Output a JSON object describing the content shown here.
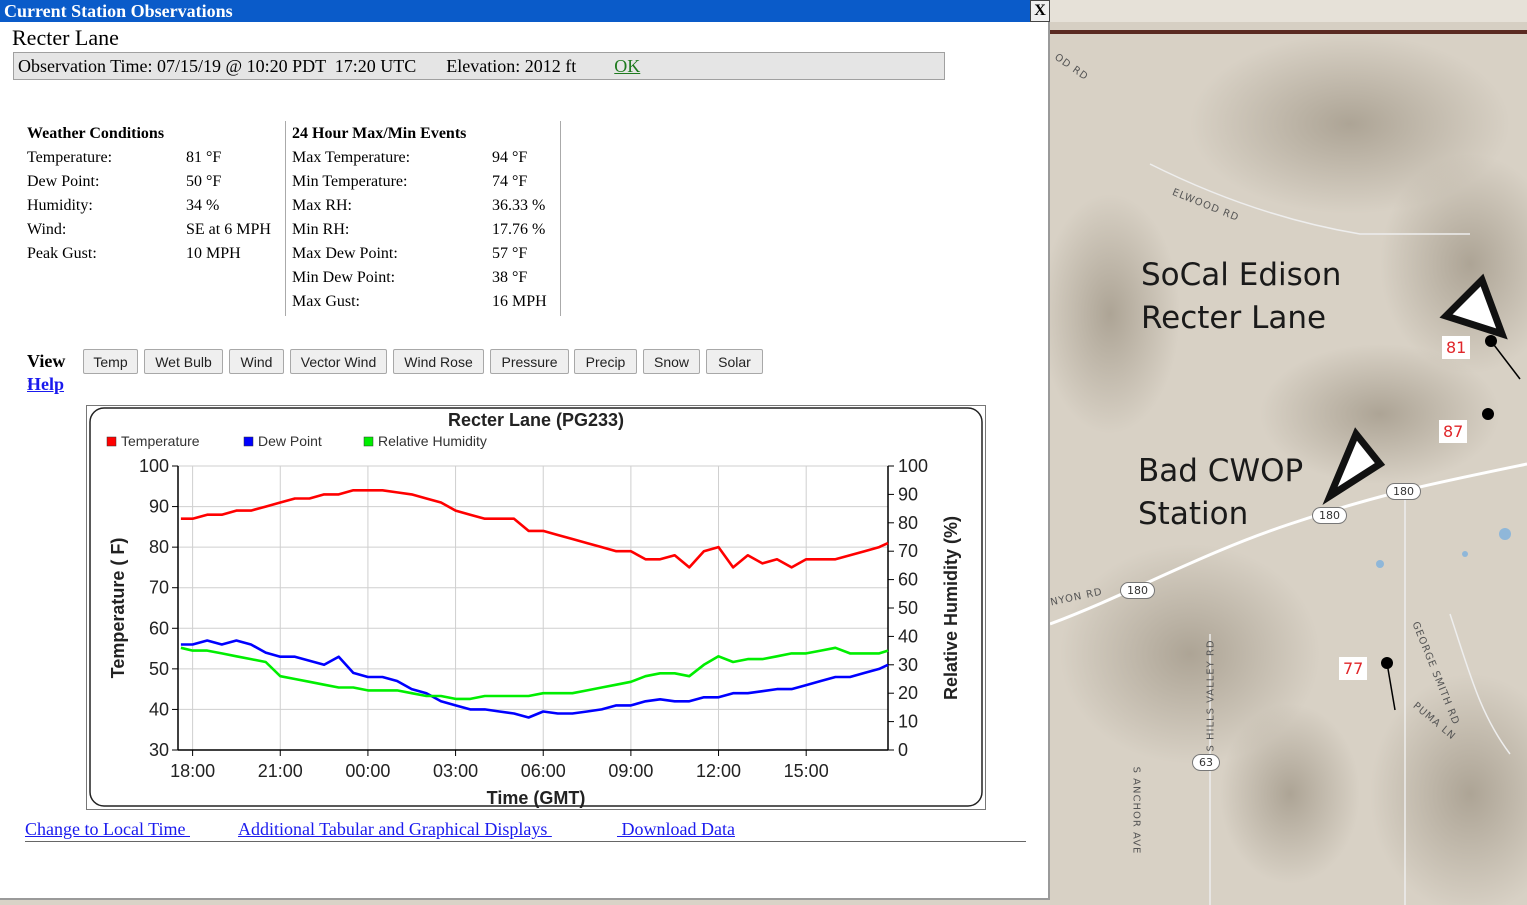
{
  "window": {
    "title": "Current Station Observations",
    "close_label": "X"
  },
  "station": {
    "name": "Recter Lane",
    "obs_time": "Observation Time: 07/15/19 @ 10:20 PDT  17:20 UTC",
    "elevation": "Elevation: 2012 ft",
    "ok_label": "OK"
  },
  "weather": {
    "heading": "Weather Conditions",
    "rows": [
      {
        "label": "Temperature:",
        "value": "81 °F"
      },
      {
        "label": "Dew Point:",
        "value": "50 °F"
      },
      {
        "label": "Humidity:",
        "value": "34 %"
      },
      {
        "label": "Wind:",
        "value": "SE at 6 MPH"
      },
      {
        "label": "Peak Gust:",
        "value": "10 MPH"
      }
    ]
  },
  "maxmin": {
    "heading": "24 Hour Max/Min Events",
    "rows": [
      {
        "label": "Max Temperature:",
        "value": "94 °F"
      },
      {
        "label": "Min Temperature:",
        "value": "74 °F"
      },
      {
        "label": "Max RH:",
        "value": "36.33 %"
      },
      {
        "label": "Min RH:",
        "value": "17.76 %"
      },
      {
        "label": "Max Dew Point:",
        "value": "57 °F"
      },
      {
        "label": "Min Dew Point:",
        "value": "38 °F"
      },
      {
        "label": "Max Gust:",
        "value": "16 MPH"
      }
    ]
  },
  "view": {
    "label": "View :",
    "buttons": [
      "Temp",
      "Wet Bulb",
      "Wind",
      "Vector Wind",
      "Wind Rose",
      "Pressure",
      "Precip",
      "Snow",
      "Solar"
    ],
    "help_label": "Help"
  },
  "links": {
    "local_time": "Change to Local Time ",
    "tabular": "Additional Tabular and Graphical Displays ",
    "download": " Download Data"
  },
  "colors": {
    "titlebar": "#0a5bc9",
    "temperature": "#ff0000",
    "dew_point": "#0000ff",
    "humidity": "#00ee00"
  },
  "chart_data": {
    "type": "line",
    "title": "Recter Lane (PG233)",
    "xlabel": "Time (GMT)",
    "ylabel": "Temperature ( F)",
    "y2label": "Relative Humidity (%)",
    "legend_placement": "top-left",
    "xlim": [
      17.5,
      41.8
    ],
    "ylim": [
      30,
      100
    ],
    "y2lim": [
      0,
      100
    ],
    "xticks": [
      18,
      21,
      24,
      27,
      30,
      33,
      36,
      39
    ],
    "xtick_labels": [
      "18:00",
      "21:00",
      "00:00",
      "03:00",
      "06:00",
      "09:00",
      "12:00",
      "15:00"
    ],
    "yticks": [
      30,
      40,
      50,
      60,
      70,
      80,
      90,
      100
    ],
    "y2ticks": [
      0,
      10,
      20,
      30,
      40,
      50,
      60,
      70,
      80,
      90,
      100
    ],
    "grid": true,
    "series": [
      {
        "name": "Temperature",
        "axis": "left",
        "x": [
          17.6,
          18.0,
          18.5,
          19.0,
          19.5,
          20.0,
          20.5,
          21.0,
          21.5,
          22.0,
          22.5,
          23.0,
          23.5,
          24.0,
          24.5,
          25.0,
          25.5,
          26.0,
          26.5,
          27.0,
          27.5,
          28.0,
          28.5,
          29.0,
          29.5,
          30.0,
          30.5,
          31.0,
          31.5,
          32.0,
          32.5,
          33.0,
          33.5,
          34.0,
          34.5,
          35.0,
          35.5,
          36.0,
          36.5,
          37.0,
          37.5,
          38.0,
          38.5,
          39.0,
          39.5,
          40.0,
          40.5,
          41.0,
          41.5,
          41.8
        ],
        "values": [
          87,
          87,
          88,
          88,
          89,
          89,
          90,
          91,
          92,
          92,
          93,
          93,
          94,
          94,
          94,
          93.5,
          93,
          92,
          91,
          89,
          88,
          87,
          87,
          87,
          84,
          84,
          83,
          82,
          81,
          80,
          79,
          79,
          77,
          77,
          78,
          75,
          79,
          80,
          75,
          78,
          76,
          77,
          75,
          77,
          77,
          77,
          78,
          79,
          80,
          81
        ]
      },
      {
        "name": "Dew Point",
        "axis": "left",
        "x": [
          17.6,
          18.0,
          18.5,
          19.0,
          19.5,
          20.0,
          20.5,
          21.0,
          21.5,
          22.0,
          22.5,
          23.0,
          23.5,
          24.0,
          24.5,
          25.0,
          25.5,
          26.0,
          26.5,
          27.0,
          27.5,
          28.0,
          28.5,
          29.0,
          29.5,
          30.0,
          30.5,
          31.0,
          31.5,
          32.0,
          32.5,
          33.0,
          33.5,
          34.0,
          34.5,
          35.0,
          35.5,
          36.0,
          36.5,
          37.0,
          37.5,
          38.0,
          38.5,
          39.0,
          39.5,
          40.0,
          40.5,
          41.0,
          41.5,
          41.8
        ],
        "values": [
          56,
          56,
          57,
          56,
          57,
          56,
          54,
          53,
          53,
          52,
          51,
          53,
          49,
          48,
          48,
          47,
          45,
          44,
          42,
          41,
          40,
          40,
          39.5,
          39,
          38,
          39.5,
          39,
          39,
          39.5,
          40,
          41,
          41,
          42,
          42.5,
          42,
          42,
          43,
          43,
          44,
          44,
          44.5,
          45,
          45,
          46,
          47,
          48,
          48,
          49,
          50,
          51
        ]
      },
      {
        "name": "Relative Humidity",
        "axis": "right",
        "x": [
          17.6,
          18.0,
          18.5,
          19.0,
          19.5,
          20.0,
          20.5,
          21.0,
          21.5,
          22.0,
          22.5,
          23.0,
          23.5,
          24.0,
          24.5,
          25.0,
          25.5,
          26.0,
          26.5,
          27.0,
          27.5,
          28.0,
          28.5,
          29.0,
          29.5,
          30.0,
          30.5,
          31.0,
          31.5,
          32.0,
          32.5,
          33.0,
          33.5,
          34.0,
          34.5,
          35.0,
          35.5,
          36.0,
          36.5,
          37.0,
          37.5,
          38.0,
          38.5,
          39.0,
          39.5,
          40.0,
          40.5,
          41.0,
          41.5,
          41.8
        ],
        "values": [
          36,
          35,
          35,
          34,
          33,
          32,
          31,
          26,
          25,
          24,
          23,
          22,
          22,
          21,
          21,
          21,
          20,
          19,
          19,
          18,
          18,
          19,
          19,
          19,
          19,
          20,
          20,
          20,
          21,
          22,
          23,
          24,
          26,
          27,
          27,
          26,
          30,
          33,
          31,
          32,
          32,
          33,
          34,
          34,
          35,
          36,
          34,
          34,
          34,
          35
        ]
      }
    ]
  }
}
